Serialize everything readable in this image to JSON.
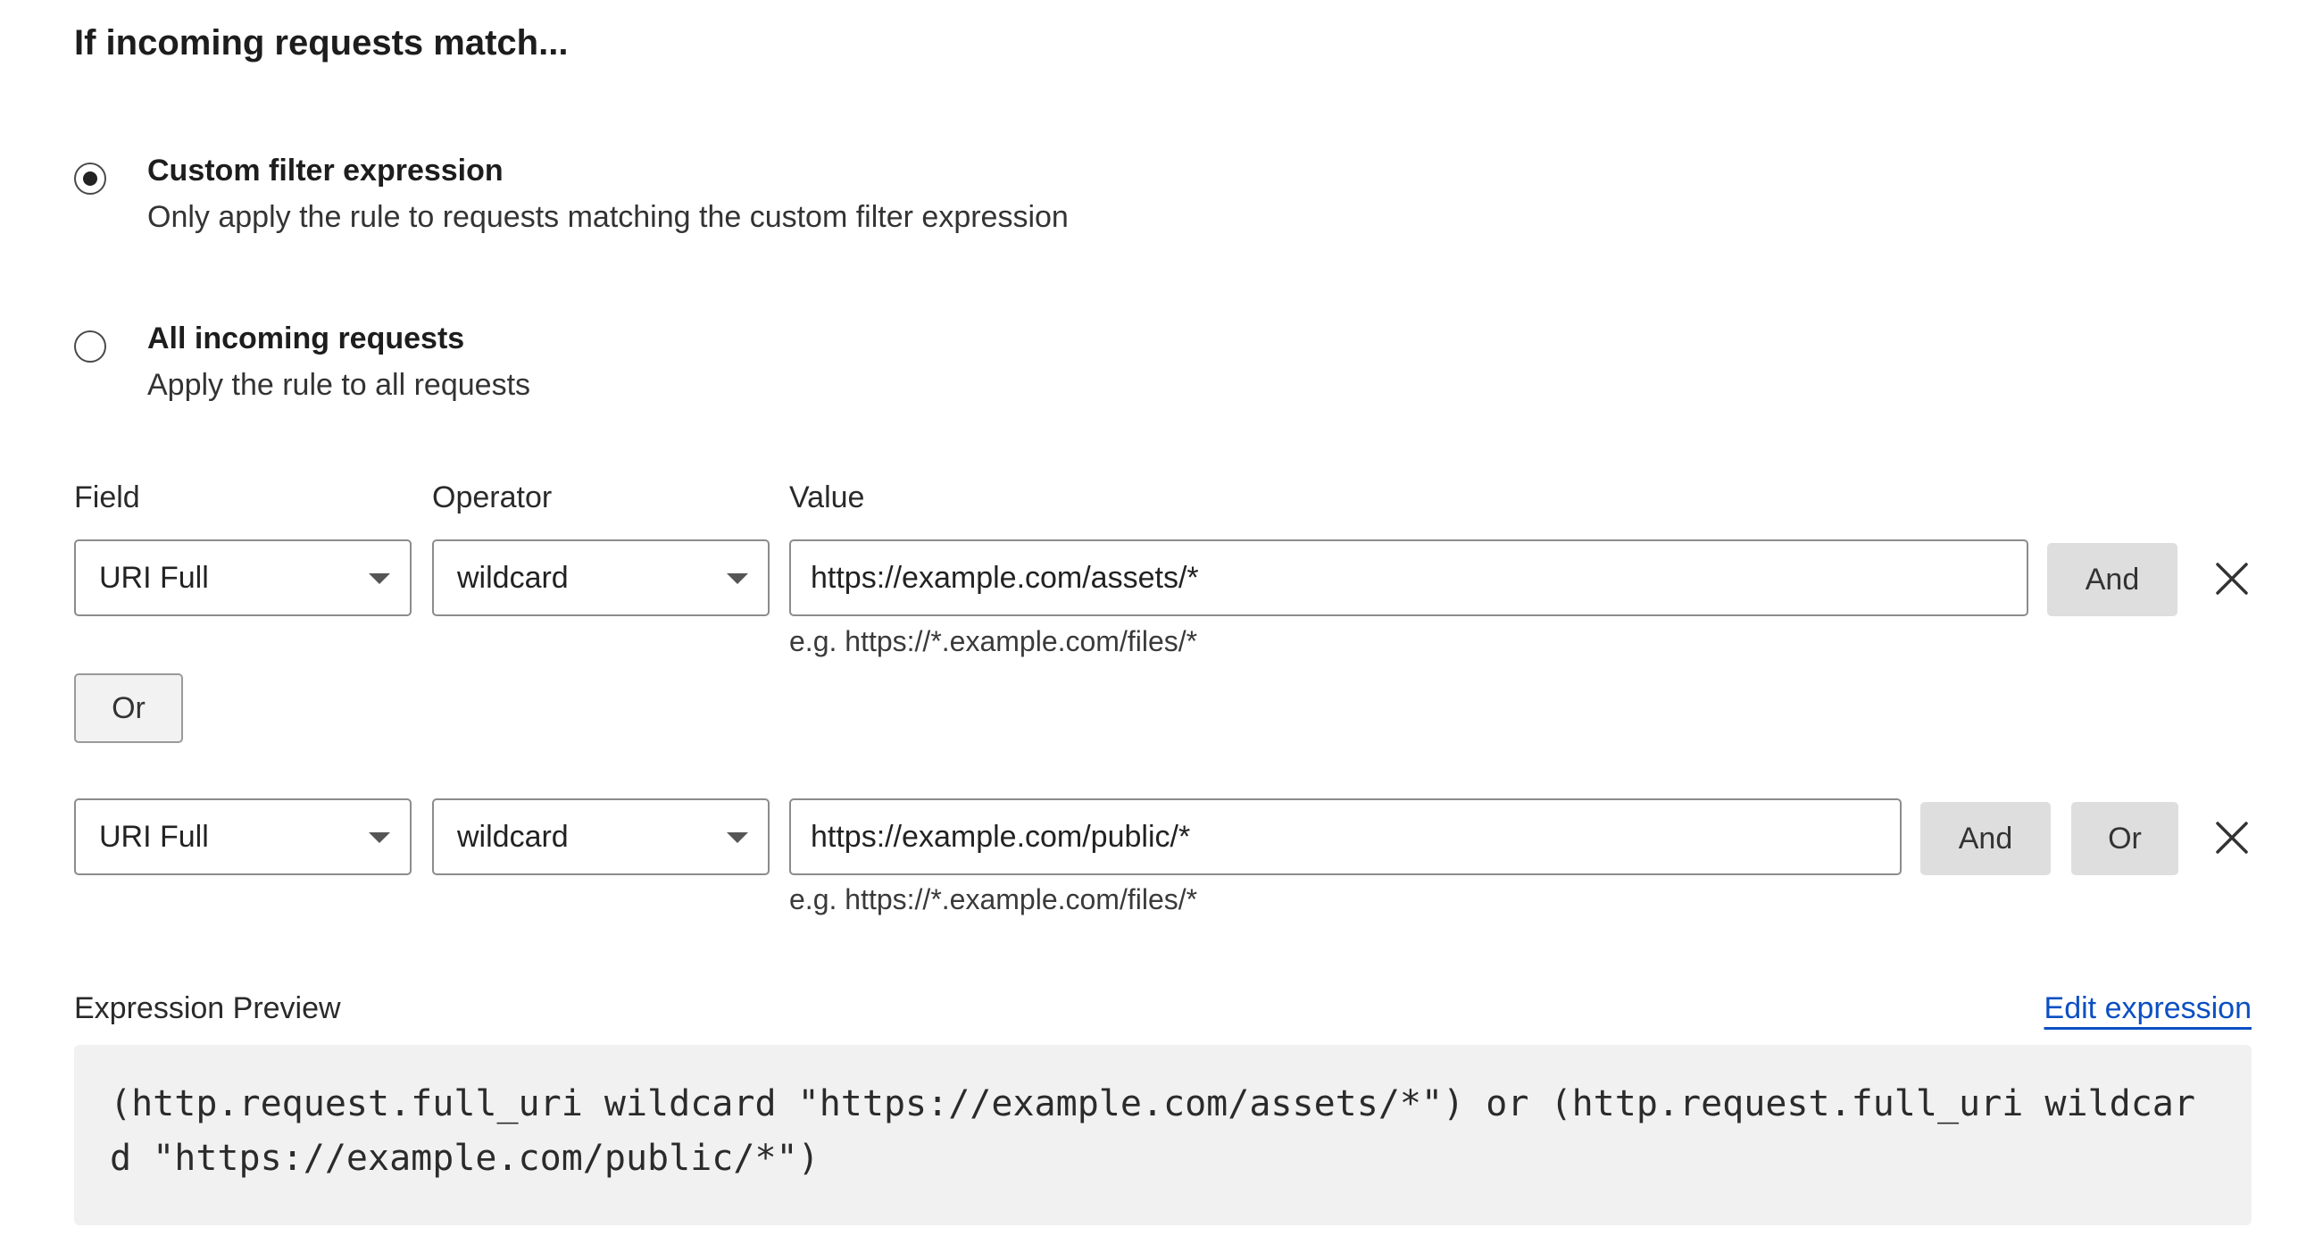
{
  "section": {
    "title": "If incoming requests match..."
  },
  "options": [
    {
      "title": "Custom filter expression",
      "description": "Only apply the rule to requests matching the custom filter expression",
      "selected": true
    },
    {
      "title": "All incoming requests",
      "description": "Apply the rule to all requests",
      "selected": false
    }
  ],
  "columns": {
    "field": "Field",
    "operator": "Operator",
    "value": "Value"
  },
  "conditions": [
    {
      "field": "URI Full",
      "operator": "wildcard",
      "value": "https://example.com/assets/*",
      "hint": "e.g. https://*.example.com/files/*",
      "and_label": "And"
    },
    {
      "field": "URI Full",
      "operator": "wildcard",
      "value": "https://example.com/public/*",
      "hint": "e.g. https://*.example.com/files/*",
      "and_label": "And",
      "or_label": "Or"
    }
  ],
  "or_separator": "Or",
  "preview": {
    "label": "Expression Preview",
    "edit_link": "Edit expression",
    "expression": "(http.request.full_uri wildcard \"https://example.com/assets/*\") or (http.request.full_uri wildcard \"https://example.com/public/*\")"
  },
  "icons": {
    "close": "close-icon",
    "dropdown": "caret-down-icon",
    "radio": "radio-icon"
  },
  "colors": {
    "link": "#0b4fc2",
    "button_gray": "#dedede",
    "preview_bg": "#f1f1f1"
  }
}
